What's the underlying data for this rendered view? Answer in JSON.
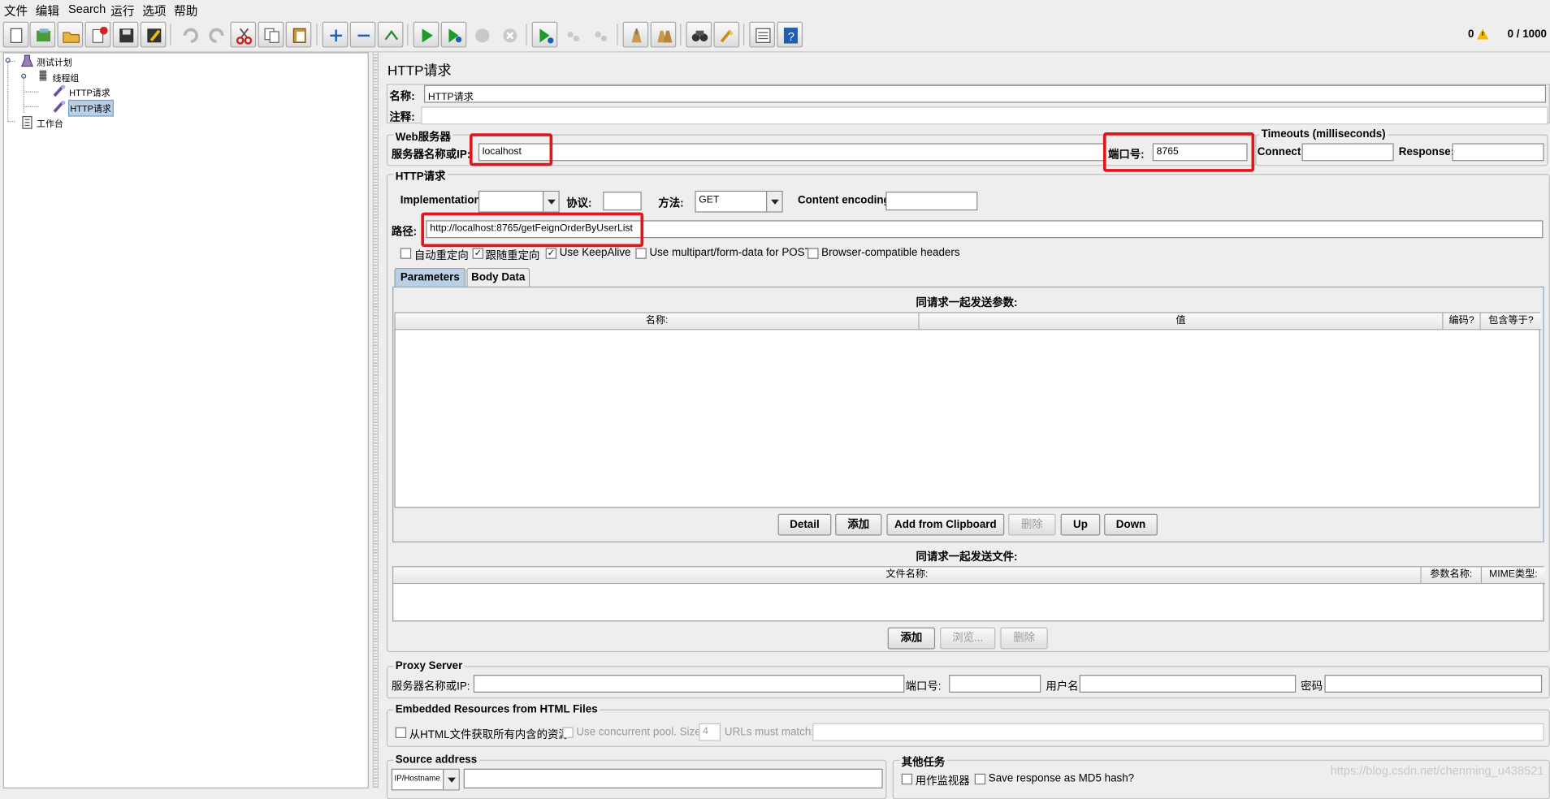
{
  "menu": [
    "文件",
    "编辑",
    "Search",
    "运行",
    "选项",
    "帮助"
  ],
  "toolbar": {
    "icons": [
      "new-icon",
      "templates-icon",
      "open-icon",
      "close-icon",
      "save-icon",
      "save-as-icon",
      "undo-icon",
      "redo-icon",
      "cut-icon",
      "copy-icon",
      "paste-icon",
      "expand-icon",
      "collapse-icon",
      "toggle-icon",
      "start-icon",
      "start-no-pause-icon",
      "stop-icon",
      "shutdown-icon",
      "remote-start-icon",
      "remote-stop-icon",
      "remote-shutdown-icon",
      "clear-icon",
      "clear-all-icon",
      "search-icon",
      "reset-search-icon",
      "function-helper-icon",
      "help-icon"
    ],
    "error_count": "0",
    "thread_count": "0 / 1000"
  },
  "tree": {
    "test_plan": "测试计划",
    "thread_group": "线程组",
    "request_1": "HTTP请求",
    "request_2": "HTTP请求",
    "workbench": "工作台"
  },
  "panel": {
    "title": "HTTP请求",
    "name_label": "名称:",
    "name_value": "HTTP请求",
    "comment_label": "注释:",
    "comment_value": ""
  },
  "web_server": {
    "title": "Web服务器",
    "host_label": "服务器名称或IP:",
    "host_value": "localhost",
    "port_label": "端口号:",
    "port_value": "8765",
    "timeouts_title": "Timeouts (milliseconds)",
    "connect_label": "Connect:",
    "response_label": "Response:"
  },
  "http_request": {
    "title": "HTTP请求",
    "impl_label": "Implementation:",
    "impl_value": "",
    "protocol_label": "协议:",
    "protocol_value": "",
    "method_label": "方法:",
    "method_value": "GET",
    "encoding_label": "Content encoding:",
    "path_label": "路径:",
    "path_value": "http://localhost:8765/getFeignOrderByUserList"
  },
  "options": [
    {
      "label": "自动重定向",
      "checked": false
    },
    {
      "label": "跟随重定向",
      "checked": true
    },
    {
      "label": "Use KeepAlive",
      "checked": true
    },
    {
      "label": "Use multipart/form-data for POST",
      "checked": false
    },
    {
      "label": "Browser-compatible headers",
      "checked": false
    }
  ],
  "tabs": [
    "Parameters",
    "Body Data"
  ],
  "params": {
    "title": "同请求一起发送参数:",
    "columns": [
      "名称:",
      "值",
      "编码?",
      "包含等于?"
    ],
    "buttons": [
      "Detail",
      "添加",
      "Add from Clipboard",
      "删除",
      "Up",
      "Down"
    ]
  },
  "files": {
    "title": "同请求一起发送文件:",
    "columns": [
      "文件名称:",
      "参数名称:",
      "MIME类型:"
    ],
    "buttons": [
      "添加",
      "浏览...",
      "删除"
    ]
  },
  "proxy": {
    "title": "Proxy Server",
    "host_label": "服务器名称或IP:",
    "port_label": "端口号:",
    "user_label": "用户名",
    "password_label": "密码"
  },
  "embedded": {
    "title": "Embedded Resources from HTML Files",
    "retrieve_label": "从HTML文件获取所有内含的资源",
    "pool_label": "Use concurrent pool. Size:",
    "pool_value": "4",
    "urls_label": "URLs must match:"
  },
  "source": {
    "title": "Source address",
    "type_value": "IP/Hostname"
  },
  "other": {
    "title": "其他任务",
    "monitor_label": "用作监视器",
    "md5_label": "Save response as MD5 hash?"
  },
  "watermark": "https://blog.csdn.net/chenming_u438521"
}
